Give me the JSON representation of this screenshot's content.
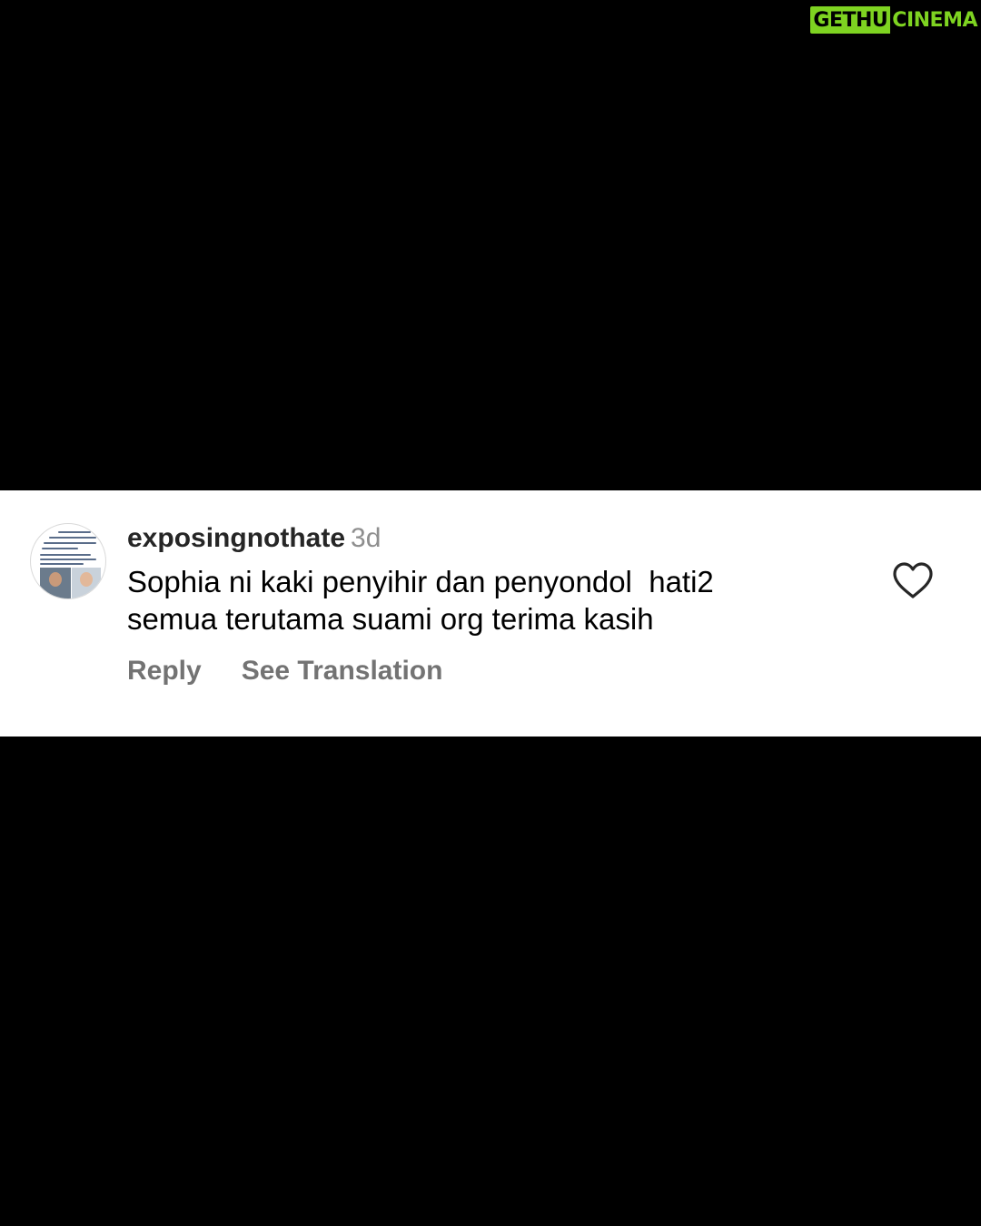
{
  "watermark": {
    "part1": "GETHU",
    "part2": "CINEMA",
    "accent_color": "#7ed321"
  },
  "comment": {
    "username": "exposingnothate",
    "timestamp": "3d",
    "text": "Sophia ni kaki penyihir dan penyondol  hati2\nsemua terutama suami org terima kasih",
    "reply_label": "Reply",
    "translation_label": "See Translation",
    "like_icon": "heart-outline-icon"
  },
  "colors": {
    "background": "#000000",
    "card": "#ffffff",
    "username": "#262626",
    "muted": "#8e8e8e"
  }
}
